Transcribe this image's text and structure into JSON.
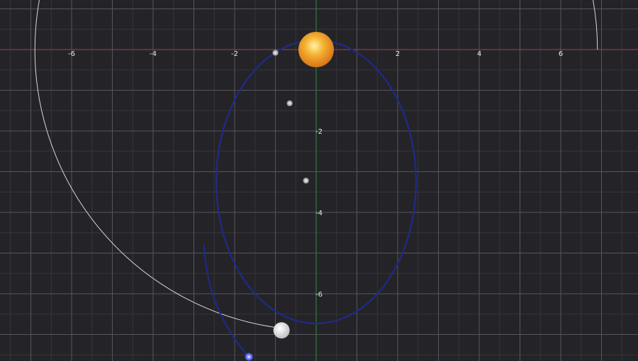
{
  "colors": {
    "background": "#242428",
    "grid_minor": "#34343a",
    "grid_major": "#55555c",
    "x_axis": "#b23a48",
    "y_axis": "#2f8a3a",
    "orbit_ellipse": "#1e2a8a",
    "trajectory_arc": "#d8d8d8",
    "sun": "#f0a020",
    "planet": "#e8e8e8",
    "probe": "#4a5cff"
  },
  "axes": {
    "x_tick_labels": [
      {
        "value": -6,
        "label": "-6"
      },
      {
        "value": -4,
        "label": "-4"
      },
      {
        "value": -2,
        "label": "-2"
      },
      {
        "value": 2,
        "label": "2"
      },
      {
        "value": 4,
        "label": "4"
      },
      {
        "value": 6,
        "label": "6"
      }
    ],
    "y_tick_labels": [
      {
        "value": -2,
        "label": "-2"
      },
      {
        "value": -4,
        "label": "-4"
      },
      {
        "value": -6,
        "label": "-6"
      }
    ]
  },
  "objects": {
    "sun": {
      "x": 0,
      "y": 0,
      "icon": "sun-icon"
    },
    "planet": {
      "x": -0.85,
      "y": -6.9,
      "icon": "planet-icon"
    },
    "probe": {
      "x": -1.65,
      "y": -7.55,
      "icon": "probe-icon"
    },
    "markers": [
      {
        "x": -1.0,
        "y": -0.08
      },
      {
        "x": -0.65,
        "y": -1.32
      },
      {
        "x": -0.25,
        "y": -3.22
      }
    ]
  },
  "orbit": {
    "center_x": 0,
    "center_y": -3.25,
    "semi_x": 2.45,
    "semi_y": 3.48
  },
  "arc": {
    "center_x": 0,
    "center_y": 0,
    "radius": 6.9
  }
}
